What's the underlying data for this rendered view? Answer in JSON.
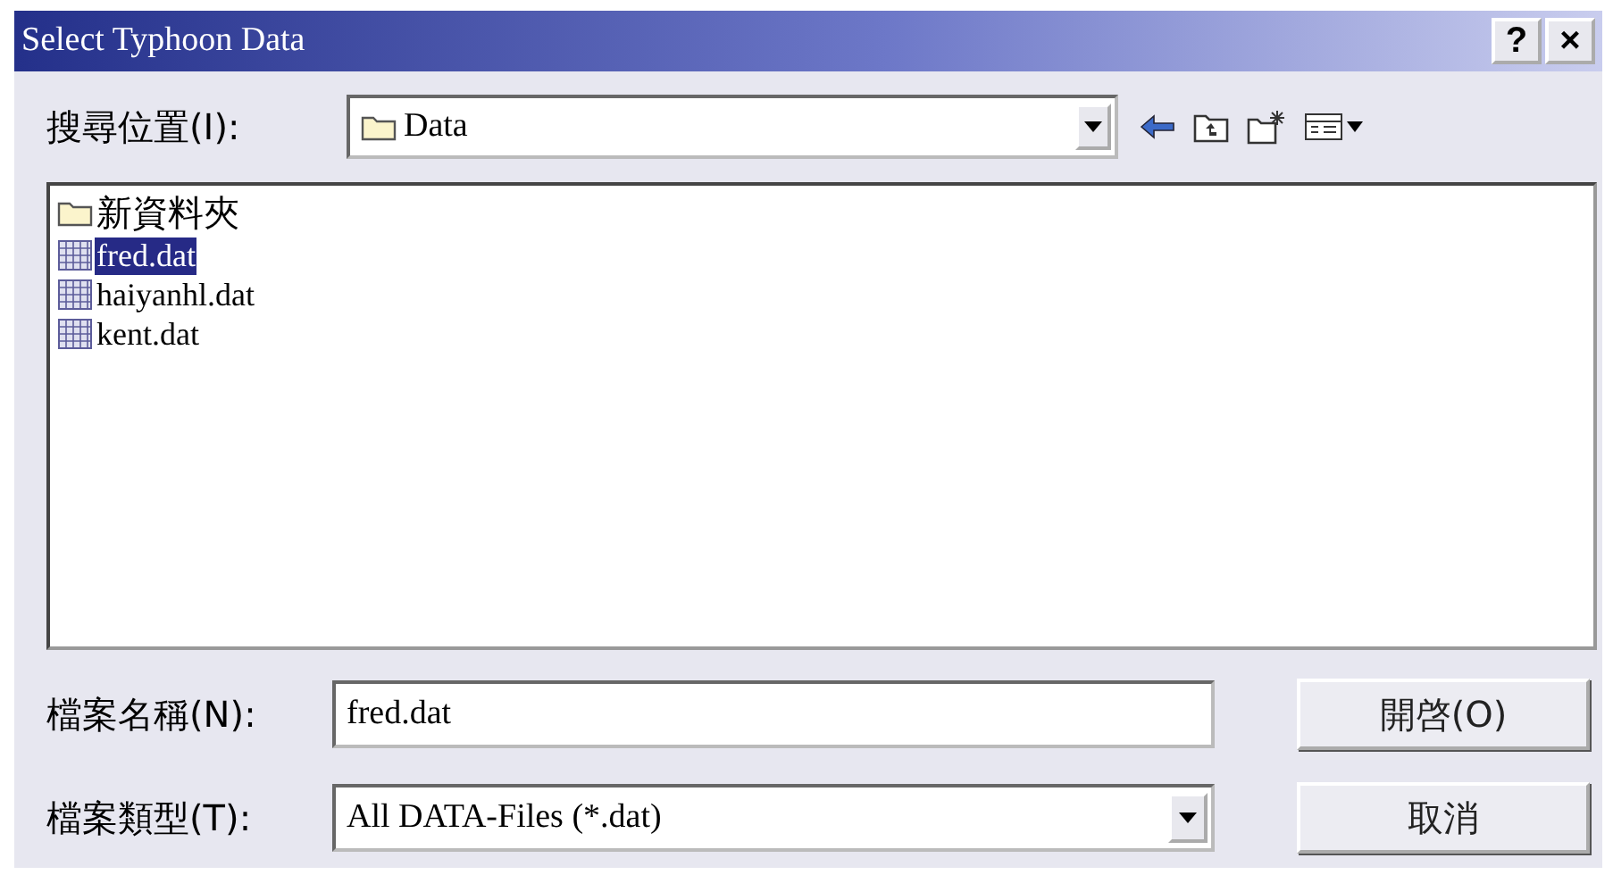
{
  "window": {
    "title": "Select Typhoon Data",
    "help": "?",
    "close": "×"
  },
  "look_in": {
    "label": "搜尋位置(I):",
    "value": "Data"
  },
  "files": [
    {
      "name": "新資料夾",
      "kind": "folder",
      "selected": false
    },
    {
      "name": "fred.dat",
      "kind": "file",
      "selected": true
    },
    {
      "name": "haiyanhl.dat",
      "kind": "file",
      "selected": false
    },
    {
      "name": "kent.dat",
      "kind": "file",
      "selected": false
    }
  ],
  "file_name": {
    "label": "檔案名稱(N):",
    "value": "fred.dat"
  },
  "file_type": {
    "label": "檔案類型(T):",
    "value": "All DATA-Files (*.dat)"
  },
  "buttons": [
    {
      "label": "開啓(O)"
    },
    {
      "label": "取消"
    }
  ]
}
